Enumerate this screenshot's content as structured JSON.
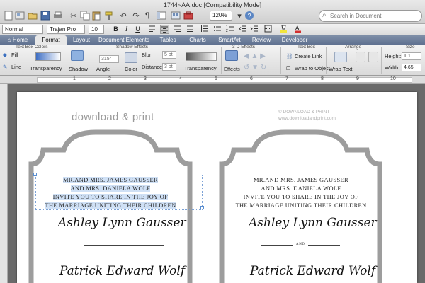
{
  "window": {
    "title": "1744~AA.doc [Compatibility Mode]"
  },
  "toolbar": {
    "search_placeholder": "Search in Document",
    "zoom": "120%",
    "icons": [
      "new-doc-icon",
      "templates-icon",
      "open-icon",
      "save-icon",
      "print-icon",
      "cut-icon",
      "copy-icon",
      "paste-icon",
      "format-painter-icon",
      "undo-icon",
      "redo-icon",
      "paragraph-icon",
      "sidebar-icon",
      "gallery-icon",
      "toolbox-icon",
      "zoom-icon",
      "help-icon"
    ]
  },
  "format_bar": {
    "style": "Normal",
    "font": "Trajan Pro",
    "size": "10",
    "bold_label": "B",
    "italic_label": "I",
    "underline_label": "U"
  },
  "ribbon": {
    "tabs": [
      {
        "label": "Home",
        "active": false
      },
      {
        "label": "Format",
        "active": true
      },
      {
        "label": "Layout",
        "active": false
      },
      {
        "label": "Document Elements",
        "active": false
      },
      {
        "label": "Tables",
        "active": false
      },
      {
        "label": "Charts",
        "active": false
      },
      {
        "label": "SmartArt",
        "active": false
      },
      {
        "label": "Review",
        "active": false
      },
      {
        "label": "Developer",
        "active": false
      }
    ],
    "groups": {
      "text_box_colors": "Text Box Colors",
      "shadow_effects": "Shadow Effects",
      "three_d_effects": "3-D Effects",
      "text_box": "Text Box",
      "arrange": "Arrange",
      "size": "Size"
    },
    "fill_label": "Fill",
    "line_label": "Line",
    "transparency_label": "Transparency",
    "shadow_label": "Shadow",
    "angle_label": "Angle",
    "angle_value": "315°",
    "color_label": "Color",
    "blur_label": "Blur:",
    "blur_value": "5 pt",
    "distance_label": "Distance:",
    "distance_value": "3 pt",
    "transparency2_label": "Transparency",
    "effects_label": "Effects",
    "create_link_label": "Create Link",
    "wrap_to_object_label": "Wrap to Object",
    "wrap_text_label": "Wrap Text",
    "height_label": "Height:",
    "height_value": "1.1",
    "width_label": "Width:",
    "width_value": "4.65"
  },
  "ruler": {
    "numbers": [
      "1",
      "2",
      "3",
      "4",
      "5",
      "6",
      "7",
      "8",
      "9",
      "10"
    ]
  },
  "page": {
    "brand_left": "download & print",
    "brand_right_line1": "© DOWNLOAD & PRINT",
    "brand_right_line2": "www.downloadandprint.com",
    "invitation_left": {
      "lines": [
        "MR.AND MRS. JAMES GAUSSER",
        "AND MRS. DANIELA WOLF",
        "INVITE YOU TO SHARE IN THE JOY OF",
        "THE MARRIAGE UNITING THEIR CHILDREN"
      ],
      "bride": {
        "first": "Ashley",
        "middle": "Lynn",
        "last": "Gausser"
      },
      "groom": "Patrick Edward Wolf"
    },
    "invitation_right": {
      "lines": [
        "MR.AND MRS. JAMES GAUSSER",
        "AND MRS. DANIELA WOLF",
        "INVITE YOU TO SHARE IN THE JOY OF",
        "THE MARRIAGE UNITING THEIR CHILDREN"
      ],
      "bride": {
        "first": "Ashley",
        "middle": "Lynn",
        "last": "Gausser"
      },
      "and_label": "AND",
      "groom": "Patrick Edward Wolf"
    }
  },
  "colors": {
    "ribbon_tab_bar": "#6f809c",
    "frame_gray": "#9d9d9d",
    "highlight": "#cfe0f5",
    "spell_red": "#d54a3a"
  }
}
